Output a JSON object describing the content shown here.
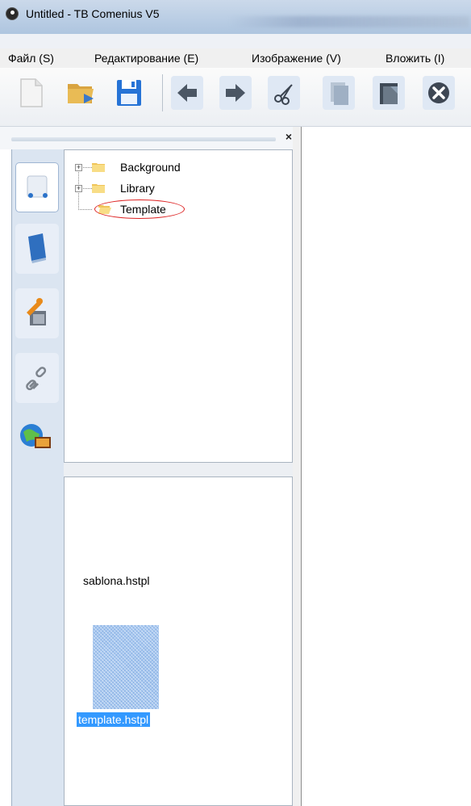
{
  "window": {
    "title": "Untitled - TB Comenius V5"
  },
  "menu": {
    "items": [
      "Файл (S)",
      "Редактирование (E)",
      "Изображение (V)",
      "Вложить (I)"
    ]
  },
  "toolbar": {
    "buttons": [
      "new-document-icon",
      "open-folder-icon",
      "save-icon",
      "back-arrow-icon",
      "forward-arrow-icon",
      "cut-icon",
      "copy-icon",
      "paste-icon",
      "delete-icon"
    ]
  },
  "panel": {
    "close_label": "×"
  },
  "sidebar": {
    "buttons": [
      "objects-tool-icon",
      "book-tool-icon",
      "tools-tool-icon",
      "link-tool-icon",
      "globe-media-tool-icon"
    ]
  },
  "tree": {
    "items": [
      {
        "label": "Background",
        "expandable": true
      },
      {
        "label": "Library",
        "expandable": true
      },
      {
        "label": "Template",
        "expandable": false,
        "highlighted": true
      }
    ]
  },
  "files": {
    "items": [
      {
        "name": "sablona.hstpl",
        "selected": false
      },
      {
        "name": "template.hstpl",
        "selected": true
      }
    ]
  },
  "colors": {
    "selection": "#3399ff",
    "highlight_ring": "#dd2222",
    "folder": "#f5d36a"
  }
}
